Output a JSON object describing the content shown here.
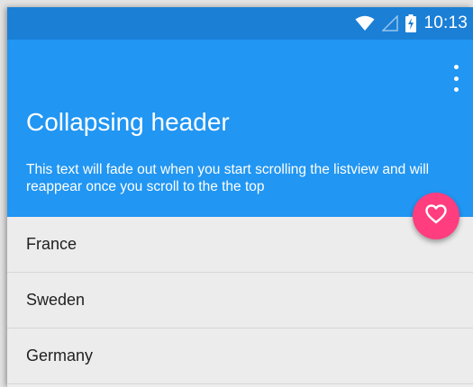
{
  "status_bar": {
    "time": "10:13",
    "icons": [
      "wifi-icon",
      "signal-icon",
      "battery-charging-icon"
    ]
  },
  "header": {
    "title": "Collapsing header",
    "subtitle": "This text will fade out when you start scrolling the listview and will reappear once you scroll to the the top",
    "menu_icon": "overflow-menu-icon"
  },
  "fab": {
    "icon": "heart-outline-icon"
  },
  "list": {
    "items": [
      "France",
      "Sweden",
      "Germany"
    ]
  },
  "colors": {
    "status_bar": "#1b7fd6",
    "header": "#2196f3",
    "fab": "#ff3d7f",
    "list_background": "#ececec"
  }
}
